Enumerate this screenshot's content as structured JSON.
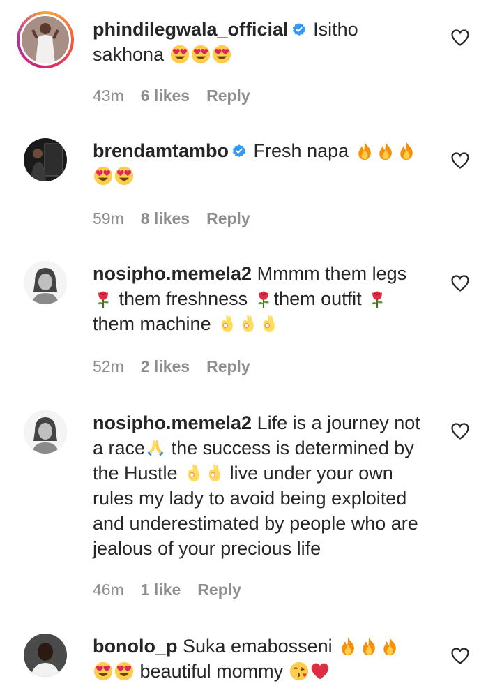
{
  "comments": [
    {
      "username": "phindilegwala_official",
      "verified": true,
      "text_lines": [
        "Isitho",
        "sakhona"
      ],
      "emojis": [
        "heart-eyes",
        "heart-eyes",
        "heart-eyes"
      ],
      "time": "43m",
      "likes": "6 likes",
      "reply": "Reply"
    },
    {
      "username": "brendamtambo",
      "verified": true,
      "text": "Fresh napa",
      "emojis": [
        "fire",
        "fire",
        "fire",
        "heart-eyes",
        "heart-eyes"
      ],
      "time": "59m",
      "likes": "8 likes",
      "reply": "Reply"
    },
    {
      "username": "nosipho.memela2",
      "verified": false,
      "text_parts": [
        "Mmmm them legs",
        "them freshness",
        "them outfit",
        "them machine"
      ],
      "emojis": [
        "rose",
        "rose",
        "rose",
        "ok-hand",
        "ok-hand",
        "ok-hand"
      ],
      "time": "52m",
      "likes": "2 likes",
      "reply": "Reply"
    },
    {
      "username": "nosipho.memela2",
      "verified": false,
      "text_parts": [
        "Life is a journey not",
        "a race",
        "the success is determined by",
        "the Hustle",
        "live under your own",
        "rules my lady to avoid being exploited",
        "and underestimated by people who are",
        "jealous of your precious life"
      ],
      "emojis": [
        "folded-hands",
        "ok-hand",
        "ok-hand"
      ],
      "time": "46m",
      "likes": "1 like",
      "reply": "Reply"
    },
    {
      "username": "bonolo_p",
      "verified": false,
      "text_parts": [
        "Suka emabosseni",
        "beautiful mommy"
      ],
      "emojis": [
        "fire",
        "fire",
        "fire",
        "heart-eyes",
        "heart-eyes",
        "kissing-heart",
        "red-heart"
      ],
      "time": "",
      "likes": "",
      "reply": ""
    }
  ],
  "colors": {
    "text": "#262626",
    "meta": "#8e8e8e",
    "verified": "#3897f0",
    "story_ring": [
      "#f9a23b",
      "#d8256c",
      "#b42e9e"
    ]
  },
  "icons": {
    "like": "heart-outline-icon",
    "verified": "verified-badge-icon"
  }
}
